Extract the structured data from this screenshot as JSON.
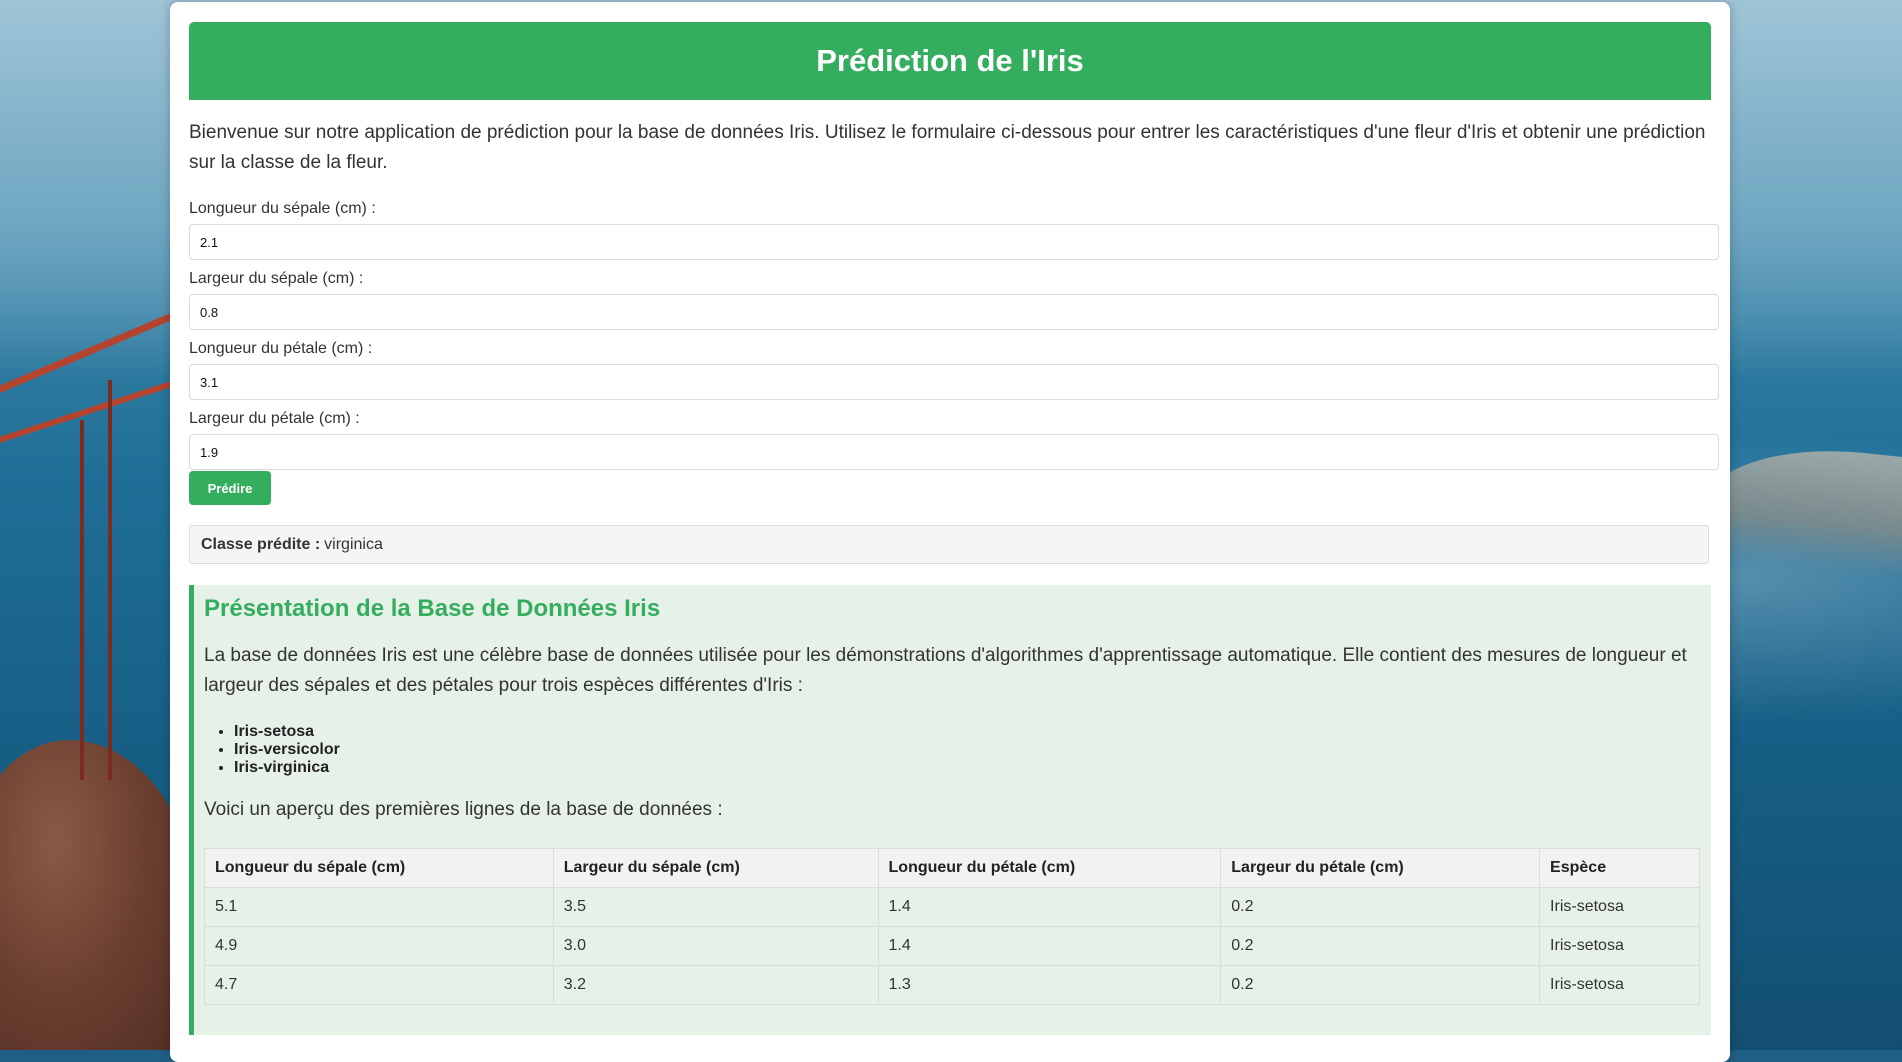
{
  "header": {
    "title": "Prédiction de l'Iris"
  },
  "intro": "Bienvenue sur notre application de prédiction pour la base de données Iris. Utilisez le formulaire ci-dessous pour entrer les caractéristiques d'une fleur d'Iris et obtenir une prédiction sur la classe de la fleur.",
  "form": {
    "sepal_length": {
      "label": "Longueur du sépale (cm) :",
      "value": "2.1"
    },
    "sepal_width": {
      "label": "Largeur du sépale (cm) :",
      "value": "0.8"
    },
    "petal_length": {
      "label": "Longueur du pétale (cm) :",
      "value": "3.1"
    },
    "petal_width": {
      "label": "Largeur du pétale (cm) :",
      "value": "1.9"
    },
    "submit_label": "Prédire"
  },
  "result": {
    "label": "Classe prédite :",
    "value": "virginica"
  },
  "database": {
    "title": "Présentation de la Base de Données Iris",
    "description": "La base de données Iris est une célèbre base de données utilisée pour les démonstrations d'algorithmes d'apprentissage automatique. Elle contient des mesures de longueur et largeur des sépales et des pétales pour trois espèces différentes d'Iris :",
    "species": [
      "Iris-setosa",
      "Iris-versicolor",
      "Iris-virginica"
    ],
    "preview_text": "Voici un aperçu des premières lignes de la base de données :",
    "table": {
      "headers": [
        "Longueur du sépale (cm)",
        "Largeur du sépale (cm)",
        "Longueur du pétale (cm)",
        "Largeur du pétale (cm)",
        "Espèce"
      ],
      "rows": [
        [
          "5.1",
          "3.5",
          "1.4",
          "0.2",
          "Iris-setosa"
        ],
        [
          "4.9",
          "3.0",
          "1.4",
          "0.2",
          "Iris-setosa"
        ],
        [
          "4.7",
          "3.2",
          "1.3",
          "0.2",
          "Iris-setosa"
        ]
      ]
    }
  },
  "colors": {
    "accent": "#34ae5e",
    "section_bg": "#e6f1e8",
    "result_bg": "#f5f5f5"
  }
}
